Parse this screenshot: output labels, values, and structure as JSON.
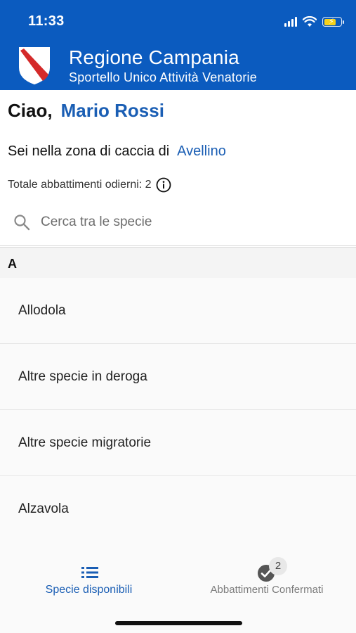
{
  "status_bar": {
    "time": "11:33"
  },
  "header": {
    "title": "Regione Campania",
    "subtitle": "Sportello Unico Attività Venatorie"
  },
  "greeting": {
    "label": "Ciao,",
    "name": "Mario Rossi"
  },
  "zone": {
    "label": "Sei nella zona di caccia di",
    "value": "Avellino"
  },
  "totals": {
    "text": "Totale abbattimenti odierni: 2"
  },
  "search": {
    "placeholder": "Cerca tra le specie",
    "value": ""
  },
  "species_list": {
    "section": "A",
    "items": [
      {
        "label": "Allodola"
      },
      {
        "label": "Altre specie in deroga"
      },
      {
        "label": "Altre specie migratorie"
      },
      {
        "label": "Alzavola"
      }
    ]
  },
  "tabbar": {
    "tabs": [
      {
        "label": "Specie disponibili",
        "icon": "list-icon",
        "active": true
      },
      {
        "label": "Abbattimenti Confermati",
        "icon": "check-circle-icon",
        "badge": "2",
        "active": false
      }
    ]
  },
  "colors": {
    "header_bg": "#0b5bbf",
    "accent": "#1a5eb4",
    "brand_stripe": "#d42a2a"
  }
}
